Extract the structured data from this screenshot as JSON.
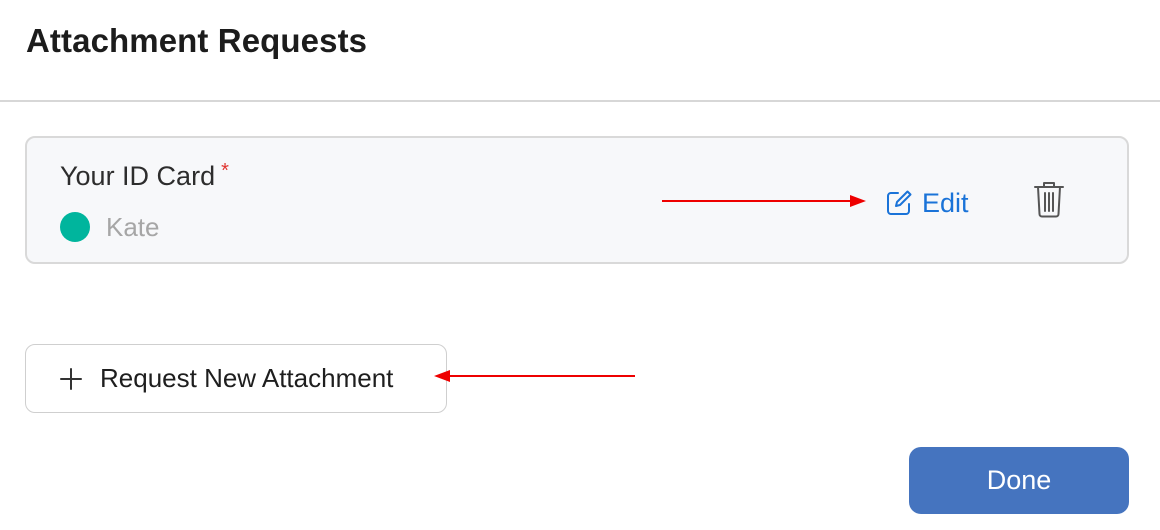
{
  "header": {
    "title": "Attachment Requests"
  },
  "request_card": {
    "title": "Your ID Card",
    "required_mark": "*",
    "assignee_name": "Kate",
    "assignee_color": "#00b59d",
    "edit_label": "Edit",
    "edit_icon": "edit-icon",
    "delete_icon": "trash-icon"
  },
  "actions": {
    "add_label": "Request New Attachment",
    "add_icon": "plus-icon",
    "done_label": "Done"
  },
  "colors": {
    "accent_link": "#1a73d8",
    "primary_button": "#4574bf",
    "required": "#e0342f",
    "annotation_arrow": "#ee0000"
  }
}
